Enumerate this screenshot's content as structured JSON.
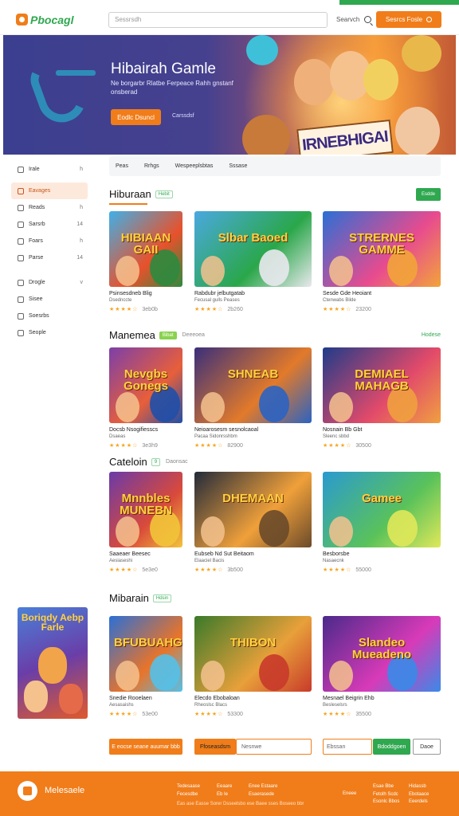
{
  "header": {
    "logo_text": "Pbocagl",
    "search_placeholder": "Sessrsdh",
    "search_label": "Searvch",
    "cta_label": "Sesrcs Fosle"
  },
  "hero": {
    "title": "Hibairah Gamle",
    "subtitle": "Ne borgarbr Rlatbe Ferpeace Rahh gnstanf onsberad",
    "button_label": "Eodlc Dsuncl",
    "link_label": "Carssdsf",
    "sign_text": "IRNEBHIGAI"
  },
  "sidebar": {
    "items": [
      {
        "label": "Irale",
        "suffix": "h"
      },
      {
        "label": "Eavages",
        "suffix": "",
        "active": true
      },
      {
        "label": "Reads",
        "suffix": "h"
      },
      {
        "label": "Sarsrb",
        "suffix": "14"
      },
      {
        "label": "Foars",
        "suffix": "h"
      },
      {
        "label": "Parse",
        "suffix": "14"
      }
    ],
    "items2": [
      {
        "label": "Drogle",
        "suffix": "v"
      },
      {
        "label": "Sisee",
        "suffix": ""
      },
      {
        "label": "Soesrbs",
        "suffix": ""
      },
      {
        "label": "Seople",
        "suffix": ""
      }
    ],
    "promo_title": "Boriqdy Aebp Farle"
  },
  "filters": [
    "Peas",
    "Rrhgs",
    "Wespeeplsbtas",
    "Sssase"
  ],
  "sections": [
    {
      "title": "Hiburaan",
      "badge": "Hebit",
      "more": "Esdde",
      "cards": [
        {
          "thumb": "HIBIAAN GAII",
          "title": "Psinsesdneb Blig",
          "sub": "Dsednccte",
          "rating": "3eb0b"
        },
        {
          "thumb": "Slbar Baoed",
          "title": "Rabdubr jelbutgatab",
          "sub": "Fecusal gulls Peases",
          "rating": "2b260"
        },
        {
          "thumb": "STRERNES GAMME",
          "title": "Sesde Gde Heoiant",
          "sub": "Ctenwabs Bilde",
          "rating": "23200"
        }
      ]
    },
    {
      "title": "Manemea",
      "badge": "Bibat",
      "sub": "Deeeoea",
      "more": "Hodese",
      "cards": [
        {
          "thumb": "Nevgbs Gonegs",
          "title": "Docsb Nsogifiesscs",
          "sub": "Dsaeas",
          "rating": "3e3h9"
        },
        {
          "thumb": "SHNEAB",
          "title": "Neioarosesm sesnolcaoal",
          "sub": "Pacaa Sidonrsshbm",
          "rating": "82900"
        },
        {
          "thumb": "DEMIAEL MAHAGB",
          "title": "Nosnain Bb Gbt",
          "sub": "Sleenc sbbd",
          "rating": "30500"
        }
      ]
    },
    {
      "title": "Cateloin",
      "badge": "9",
      "sub": "Daonsac",
      "cards": [
        {
          "thumb": "Mnnbles MUNEBN",
          "title": "Saaeaer Beesec",
          "sub": "Aesiaseshi",
          "rating": "5e3e0"
        },
        {
          "thumb": "DHEMAAN",
          "title": "Eubseb Nd Sut Beitaom",
          "sub": "Elaaciel Bacis",
          "rating": "3b500"
        },
        {
          "thumb": "Gamee",
          "title": "Besborsbe",
          "sub": "Nasaecnk",
          "rating": "55000"
        }
      ]
    },
    {
      "title": "Mibarain",
      "badge": "Hdsin",
      "cards": [
        {
          "thumb": "BFUBUAHGE",
          "title": "Snedie Rooelaen",
          "sub": "Aesasaishs",
          "rating": "53e00"
        },
        {
          "thumb": "THIBON",
          "title": "Elecdo Ebobaloan",
          "sub": "Rheoslsc Blacs",
          "rating": "53300"
        },
        {
          "thumb": "Slandeo Mueadeno",
          "title": "Mesnael Beigrin Ehb",
          "sub": "Besleselsrs",
          "rating": "35500"
        }
      ]
    }
  ],
  "bottom_controls": {
    "btn1": "E eocse seane auumar bbb",
    "btn2": "Ffoseasdsm",
    "input2": "Nesnwe",
    "input3": "Ebssan",
    "btn3": "Bdoddgoen",
    "btn4": "Daoe"
  },
  "footer": {
    "name": "Melesaele",
    "col1": [
      "Tedesaase",
      "Fecesdbe"
    ],
    "col2": [
      "Eeaare",
      "Eb Ie"
    ],
    "col3": [
      "Enee Estaare",
      "Esaerasede"
    ],
    "col4": [
      "Eneee"
    ],
    "col5": [
      "Esae Bbe",
      "Fetolh Scdc",
      "Esonlc Bbos"
    ],
    "col6": [
      "Hidassb",
      "Ebotaace",
      "Eeerdels"
    ],
    "bottom": "Eas ase Easse Sorer Dsseelsbo ese Baee sses Boseeo bbr"
  },
  "colors": {
    "accent": "#f07d1a",
    "green": "#2fa84f",
    "hero_bg": "#3b3f8f"
  }
}
